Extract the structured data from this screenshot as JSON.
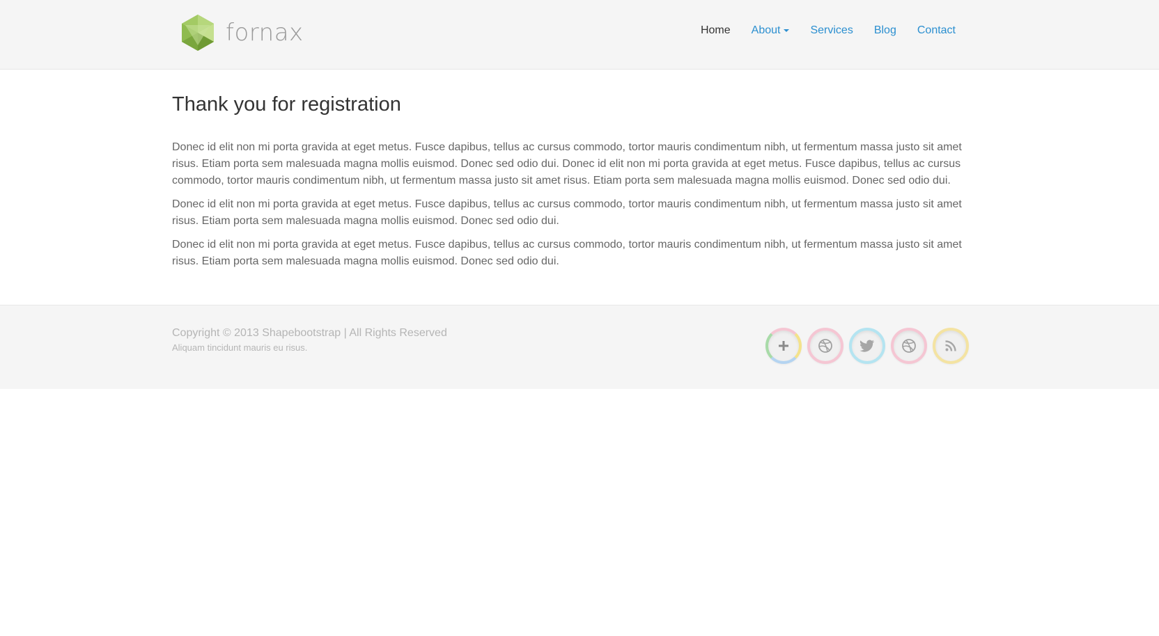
{
  "brand": {
    "name": "fornax",
    "colors": {
      "light": "#a9cf6a",
      "mid": "#8cb84a",
      "dark": "#6f9a34"
    }
  },
  "nav": {
    "items": [
      {
        "label": "Home",
        "active": true
      },
      {
        "label": "About",
        "dropdown": true
      },
      {
        "label": "Services"
      },
      {
        "label": "Blog"
      },
      {
        "label": "Contact"
      }
    ],
    "link_color": "#2b8fd0",
    "active_color": "#333333"
  },
  "main": {
    "title": "Thank you for registration",
    "paragraphs": [
      "Donec id elit non mi porta gravida at eget metus. Fusce dapibus, tellus ac cursus commodo, tortor mauris condimentum nibh, ut fermentum massa justo sit amet risus. Etiam porta sem malesuada magna mollis euismod. Donec sed odio dui. Donec id elit non mi porta gravida at eget metus. Fusce dapibus, tellus ac cursus commodo, tortor mauris condimentum nibh, ut fermentum massa justo sit amet risus. Etiam porta sem malesuada magna mollis euismod. Donec sed odio dui.",
      "Donec id elit non mi porta gravida at eget metus. Fusce dapibus, tellus ac cursus commodo, tortor mauris condimentum nibh, ut fermentum massa justo sit amet risus. Etiam porta sem malesuada magna mollis euismod. Donec sed odio dui.",
      "Donec id elit non mi porta gravida at eget metus. Fusce dapibus, tellus ac cursus commodo, tortor mauris condimentum nibh, ut fermentum massa justo sit amet risus. Etiam porta sem malesuada magna mollis euismod. Donec sed odio dui."
    ]
  },
  "footer": {
    "copyright": "Copyright © 2013 Shapebootstrap | All Rights Reserved",
    "tagline": "Aliquam tincidunt mauris eu risus.",
    "social": [
      {
        "icon": "google-plus-icon",
        "ring_color": "#f4e28a"
      },
      {
        "icon": "dribbble-icon",
        "ring_color": "#f5c6d3"
      },
      {
        "icon": "twitter-icon",
        "ring_color": "#b4e4f1"
      },
      {
        "icon": "dribbble-icon",
        "ring_color": "#f5c6d3"
      },
      {
        "icon": "rss-icon",
        "ring_color": "#f4e3a2"
      }
    ]
  }
}
